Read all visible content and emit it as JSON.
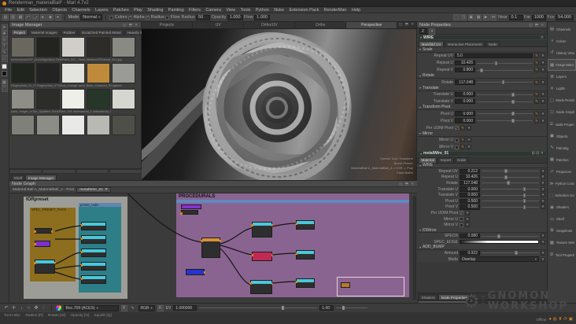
{
  "titlebar": {
    "title": "Renderman_materialBall* - Mari 4.7v2"
  },
  "menu": {
    "items": [
      "File",
      "Edit",
      "Selection",
      "Objects",
      "Channels",
      "Layers",
      "Patches",
      "Play",
      "Shading",
      "Painting",
      "Filters",
      "Camera",
      "View",
      "Tools",
      "Python",
      "Nuke",
      "Extension Pack",
      "RenderMan",
      "Help"
    ]
  },
  "toolbar": {
    "left_icons": [
      {
        "glyph": "▤"
      },
      {
        "glyph": "▥"
      },
      {
        "glyph": "▦"
      },
      {
        "glyph": "⤺"
      },
      {
        "glyph": "⤻"
      },
      {
        "glyph": "⬖"
      },
      {
        "glyph": "◉"
      },
      {
        "glyph": "●"
      }
    ],
    "mode_label": "Mode",
    "mode_value": "Normal",
    "toggles": [
      {
        "label": "Colors",
        "checked": false
      },
      {
        "label": "Alpha",
        "checked": true
      },
      {
        "label": "Radius",
        "checked": true
      },
      {
        "label": "Flow",
        "checked": false
      }
    ],
    "fields": [
      {
        "label": "Radius",
        "value": "50"
      },
      {
        "label": "Opacity",
        "value": "1.000"
      },
      {
        "label": "Flow",
        "value": "1.000"
      }
    ],
    "right_icons": [
      {
        "glyph": "⬚"
      },
      {
        "glyph": "◫"
      },
      {
        "glyph": "▣"
      },
      {
        "glyph": "▦"
      },
      {
        "glyph": "▶"
      },
      {
        "glyph": "⋈"
      }
    ],
    "camera_fields": [
      {
        "label": "Near",
        "value": "0.1"
      },
      {
        "label": "Far",
        "value": "1000"
      },
      {
        "label": "Fov",
        "value": "54.000"
      }
    ]
  },
  "tool_strip": {
    "items": [
      {
        "glyph": "➤"
      },
      {
        "glyph": "✥"
      },
      {
        "glyph": "⊙"
      },
      {
        "glyph": "T"
      },
      {
        "glyph": "✎"
      },
      {
        "glyph": "▭"
      }
    ],
    "fg_color": "#e8e8e8",
    "bg_color": "#141414",
    "spheres": [
      "#d8871f",
      "#c47a1c",
      "#d8871f",
      "#b06e18"
    ],
    "bottom_icons": [
      {
        "glyph": "▦"
      },
      {
        "glyph": "⬚"
      }
    ]
  },
  "image_manager": {
    "title": "Image Manager",
    "corner_icons": "◱ ⬒ ✕",
    "tabs": [
      {
        "label": "Project",
        "active": true
      },
      {
        "label": "Material Images"
      },
      {
        "label": "Rubber"
      },
      {
        "label": "Scratched Painted Metal"
      },
      {
        "label": "Heavily Sc"
      }
    ],
    "tab_add": "+",
    "tab_close": "✕",
    "rows": [
      {
        "caption": "serverAcmeEXP_AnooIngocllace DirtuPaint_001_ Steel_Medium03Trackal_001.jpg",
        "thumbs": [
          "#6a675f",
          "#23231f",
          "#cfcfc8",
          "#2e2c28",
          "#8a8a84"
        ]
      },
      {
        "caption": "Fingerprints_01_Fi Fingerprints_07 Metal_Orange sand_Base_Coloured_Roughnes",
        "thumbs": [
          "#20261e",
          "#232323",
          "#e4e4de",
          "#c08a3c",
          "#9a9a96"
        ]
      },
      {
        "caption": "sand_Height_of Em_Splatters SchizPaint_001 antimaterial_1 antimaterial_f",
        "thumbs": [
          "#8e8e86",
          "#2c2c28",
          "#efefe9",
          "#26372a",
          "#d6d6d0"
        ]
      },
      {
        "caption": "",
        "thumbs": [
          "#80807a",
          "#8d8d87",
          "#e9e9e7",
          "#b9b9b3",
          "#4f4f49"
        ]
      }
    ]
  },
  "shelf_tabs": {
    "items": [
      {
        "label": "Shelf"
      },
      {
        "label": "Image Manager",
        "active": true
      }
    ]
  },
  "node_graph": {
    "title": "Node Graph",
    "corner_icons": "◱ ⬒ ✕",
    "breadcrumb": "Material Ball A_MaterialBall_A - Root",
    "tab_label": "metalWire_01",
    "tab_close": "✕",
    "frames": {
      "ior_label": "IORpreset",
      "spec_label": "SPEC_PRESET_PHYS",
      "radio_label": "preset_radio",
      "proc_label": "PROCEDURALS"
    }
  },
  "viewport": {
    "tabs": [
      {
        "label": "Projects"
      },
      {
        "label": "UV"
      },
      {
        "label": "Ortho/UV"
      },
      {
        "label": "Ortho"
      },
      {
        "label": "Perspective",
        "active": true
      }
    ],
    "corner_icons": "◱ ⬒ ✕",
    "overlay_lines": [
      "Current Tool: Transform",
      "Brush Preset:",
      "MaterialBall A_MaterialBall_A -> IOR -> Poly",
      "Paint Buffer"
    ]
  },
  "node_properties": {
    "title": "Node Properties",
    "corner_icons": "◱ ⬒ ✕",
    "filter_value": "2",
    "wire": {
      "title": "WIRE",
      "close": "✕",
      "tabs": [
        {
          "label": "Manifold UV",
          "active": true
        },
        {
          "label": "Interactive Placement"
        },
        {
          "label": "Node"
        }
      ],
      "groups": [
        {
          "title": "Scale",
          "rows": [
            {
              "label": "Repeat UV",
              "value": "5.0",
              "wide": true
            },
            {
              "label": "Repeat U",
              "value": "10.426",
              "pct": "32%"
            },
            {
              "label": "Repeat V",
              "value": "0.800",
              "pct": "6%"
            }
          ]
        },
        {
          "title": "Rotate",
          "rows": [
            {
              "label": "Rotate",
              "value": "117.048",
              "pct": "45%"
            }
          ]
        },
        {
          "title": "Translate",
          "rows": [
            {
              "label": "Translate U",
              "value": "0.000",
              "pct": "62%"
            },
            {
              "label": "Translate V",
              "value": "0.000",
              "pct": "62%"
            }
          ]
        },
        {
          "title": "Transform Pivot",
          "rows": [
            {
              "label": "Pivot U",
              "value": "0.000",
              "pct": "62%"
            },
            {
              "label": "Pivot V",
              "value": "0.000",
              "pct": "62%"
            },
            {
              "label": "Per UDIM Pivot",
              "is_check": true,
              "checked": true
            }
          ]
        },
        {
          "title": "Mirror",
          "rows": [
            {
              "label": "Mirror U",
              "is_check": true
            },
            {
              "label": "Mirror V",
              "is_check": true
            }
          ]
        }
      ]
    },
    "material": {
      "title": "metalWire_01",
      "corner_icons": "⊞ ⊟ ✕",
      "tabs": [
        {
          "label": "Material",
          "active": true
        },
        {
          "label": "Export"
        },
        {
          "label": "Node"
        }
      ],
      "groups": [
        {
          "title": "WIRE",
          "rows": [
            {
              "label": "Repeat UV",
              "value": "0.212",
              "pct": "40%"
            },
            {
              "label": "Repeat U",
              "value": "10.426",
              "pct": "40%"
            },
            {
              "label": "Rotate",
              "value": "117.048",
              "pct": "44%"
            },
            {
              "label": "Translate U",
              "value": "0.000",
              "pct": "72%"
            },
            {
              "label": "Translate V",
              "value": "0.000",
              "pct": "72%"
            },
            {
              "label": "Pivot U",
              "value": "0.500",
              "pct": "72%"
            },
            {
              "label": "Pivot V",
              "value": "0.500",
              "pct": "72%"
            },
            {
              "label": "Per UDIM Pivot",
              "is_check": true,
              "checked": true
            },
            {
              "label": "Mirror U",
              "is_check": true
            },
            {
              "label": "Mirror V",
              "is_check": true
            }
          ]
        },
        {
          "title": "IORIron",
          "rows": [
            {
              "label": "SPECR",
              "value": "0.080",
              "pct": "28%"
            },
            {
              "label": "SPEC_EDGE",
              "gradient": true
            }
          ]
        },
        {
          "title": "ADD_BUMP",
          "rows": [
            {
              "label": "Amount",
              "value": "0.922",
              "pct": "58%"
            },
            {
              "label": "Mode",
              "option": "Overlay"
            }
          ]
        }
      ]
    },
    "bottom_tabs": [
      {
        "label": "Shaders"
      },
      {
        "label": "Node Properties",
        "active": true
      }
    ]
  },
  "dock": {
    "items": [
      {
        "label": "Channels",
        "glyph": "▤"
      },
      {
        "label": "Colors",
        "glyph": "◑"
      },
      {
        "label": "History View",
        "glyph": "↺"
      },
      {
        "label": "Image Manager",
        "glyph": "▦",
        "active": true
      },
      {
        "label": "Layers",
        "glyph": "≣"
      },
      {
        "label": "Lights",
        "glyph": "☀"
      },
      {
        "label": "Modo Render",
        "glyph": "▢"
      },
      {
        "label": "Node Graph",
        "glyph": "⬡"
      },
      {
        "label": "Node Properties",
        "glyph": "☰"
      },
      {
        "label": "Objects",
        "glyph": "▣"
      },
      {
        "label": "Painting",
        "glyph": "✎"
      },
      {
        "label": "Patches",
        "glyph": "▦"
      },
      {
        "label": "Projectors",
        "glyph": "▱"
      },
      {
        "label": "Python Console",
        "glyph": "≫"
      },
      {
        "label": "Selection Groups",
        "glyph": "⬚"
      },
      {
        "label": "Shaders",
        "glyph": "◉"
      },
      {
        "label": "Shelf",
        "glyph": "▭"
      },
      {
        "label": "Snapshots",
        "glyph": "⧉"
      },
      {
        "label": "Texture Sets",
        "glyph": "▩"
      },
      {
        "label": "Tool Properties",
        "glyph": "⚙"
      }
    ]
  },
  "bottombar": {
    "icons": [
      {
        "glyph": "↶"
      },
      {
        "glyph": "✛"
      },
      {
        "glyph": "↓"
      },
      {
        "glyph": "○"
      },
      {
        "glyph": "✥"
      },
      {
        "glyph": "◌"
      }
    ],
    "display_value": "Rec.709 (ACES)",
    "reset_label": "R",
    "channel_value": "RGB",
    "reset2_label": "R",
    "ev_label": "EV",
    "ev_value": "1.000000",
    "gain_value": "1.00"
  },
  "helpbar": {
    "prefix": "Tool Help:",
    "shortcuts": [
      "Radius [R]",
      "Rotate [W]",
      "Opacity [O]",
      "Squish [Q]"
    ]
  },
  "status": {
    "offline_label": "Offline",
    "icons": [
      {
        "glyph": "●"
      },
      {
        "glyph": "◍"
      },
      {
        "glyph": "⬆"
      },
      {
        "glyph": "⟳"
      },
      {
        "glyph": "▣"
      }
    ]
  },
  "watermark": {
    "the": "THE",
    "line1": "GNOMON",
    "line2": "WORKSHOP",
    "gear": "⚙"
  },
  "palette": {
    "accent_orange": "#d8871f",
    "frame_spec": "#8d6e1e",
    "frame_radio": "#2e7e88",
    "frame_radio_header": "#6286b0",
    "frame_proc": "#8a6490",
    "frame_proc_header": "#5d8ac2",
    "node_teal": "#49c8dc",
    "node_orange": "#d8913a",
    "node_crimson": "#c12a55",
    "node_purple": "#8a2fd6",
    "node_blue": "#2733cc",
    "canvas_light": "#9d9d97"
  }
}
